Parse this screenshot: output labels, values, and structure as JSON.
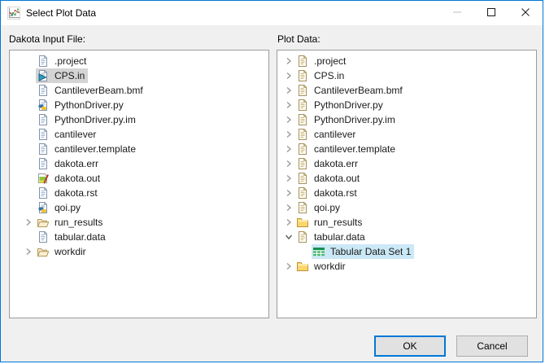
{
  "window": {
    "title": "Select Plot Data"
  },
  "left_panel": {
    "label": "Dakota Input File:",
    "items": [
      {
        "label": ".project",
        "icon": "file",
        "chevron": null,
        "selected": null,
        "indent": 0
      },
      {
        "label": "CPS.in",
        "icon": "dakota-input-file",
        "chevron": null,
        "selected": "inactive",
        "indent": 0
      },
      {
        "label": "CantileverBeam.bmf",
        "icon": "file",
        "chevron": null,
        "selected": null,
        "indent": 0
      },
      {
        "label": "PythonDriver.py",
        "icon": "python-file",
        "chevron": null,
        "selected": null,
        "indent": 0
      },
      {
        "label": "PythonDriver.py.im",
        "icon": "file",
        "chevron": null,
        "selected": null,
        "indent": 0
      },
      {
        "label": "cantilever",
        "icon": "file",
        "chevron": null,
        "selected": null,
        "indent": 0
      },
      {
        "label": "cantilever.template",
        "icon": "file",
        "chevron": null,
        "selected": null,
        "indent": 0
      },
      {
        "label": "dakota.err",
        "icon": "file",
        "chevron": null,
        "selected": null,
        "indent": 0
      },
      {
        "label": "dakota.out",
        "icon": "output-log-file",
        "chevron": null,
        "selected": null,
        "indent": 0
      },
      {
        "label": "dakota.rst",
        "icon": "file",
        "chevron": null,
        "selected": null,
        "indent": 0
      },
      {
        "label": "qoi.py",
        "icon": "python-file",
        "chevron": null,
        "selected": null,
        "indent": 0
      },
      {
        "label": "run_results",
        "icon": "folder-open",
        "chevron": "collapsed",
        "selected": null,
        "indent": 0
      },
      {
        "label": "tabular.data",
        "icon": "file",
        "chevron": null,
        "selected": null,
        "indent": 0
      },
      {
        "label": "workdir",
        "icon": "folder-open",
        "chevron": "collapsed",
        "selected": null,
        "indent": 0
      }
    ]
  },
  "right_panel": {
    "label": "Plot Data:",
    "items": [
      {
        "label": ".project",
        "icon": "file-tan",
        "chevron": "collapsed",
        "selected": null,
        "indent": 0
      },
      {
        "label": "CPS.in",
        "icon": "file-tan",
        "chevron": "collapsed",
        "selected": null,
        "indent": 0
      },
      {
        "label": "CantileverBeam.bmf",
        "icon": "file-tan",
        "chevron": "collapsed",
        "selected": null,
        "indent": 0
      },
      {
        "label": "PythonDriver.py",
        "icon": "file-tan",
        "chevron": "collapsed",
        "selected": null,
        "indent": 0
      },
      {
        "label": "PythonDriver.py.im",
        "icon": "file-tan",
        "chevron": "collapsed",
        "selected": null,
        "indent": 0
      },
      {
        "label": "cantilever",
        "icon": "file-tan",
        "chevron": "collapsed",
        "selected": null,
        "indent": 0
      },
      {
        "label": "cantilever.template",
        "icon": "file-tan",
        "chevron": "collapsed",
        "selected": null,
        "indent": 0
      },
      {
        "label": "dakota.err",
        "icon": "file-tan",
        "chevron": "collapsed",
        "selected": null,
        "indent": 0
      },
      {
        "label": "dakota.out",
        "icon": "file-tan",
        "chevron": "collapsed",
        "selected": null,
        "indent": 0
      },
      {
        "label": "dakota.rst",
        "icon": "file-tan",
        "chevron": "collapsed",
        "selected": null,
        "indent": 0
      },
      {
        "label": "qoi.py",
        "icon": "file-tan",
        "chevron": "collapsed",
        "selected": null,
        "indent": 0
      },
      {
        "label": "run_results",
        "icon": "folder-closed",
        "chevron": "collapsed",
        "selected": null,
        "indent": 0
      },
      {
        "label": "tabular.data",
        "icon": "file-tan",
        "chevron": "expanded",
        "selected": null,
        "indent": 0
      },
      {
        "label": "Tabular Data Set 1",
        "icon": "table-data",
        "chevron": null,
        "selected": "active",
        "indent": 1
      },
      {
        "label": "workdir",
        "icon": "folder-closed",
        "chevron": "collapsed",
        "selected": null,
        "indent": 0
      }
    ]
  },
  "footer": {
    "ok": "OK",
    "cancel": "Cancel"
  },
  "colors": {
    "window_border": "#0078d7",
    "dialog_background": "#f0f0f0",
    "titlebar_background": "#ffffff",
    "selection_active": "#cbe8f6",
    "selection_inactive": "#d4d4d4"
  },
  "icons": [
    "plot-icon",
    "minimize-icon",
    "maximize-icon",
    "close-icon",
    "chevron-right-icon",
    "chevron-down-icon",
    "file-icon",
    "dakota-input-file-icon",
    "python-file-icon",
    "output-log-file-icon",
    "folder-open-icon",
    "folder-closed-icon",
    "table-data-icon"
  ]
}
